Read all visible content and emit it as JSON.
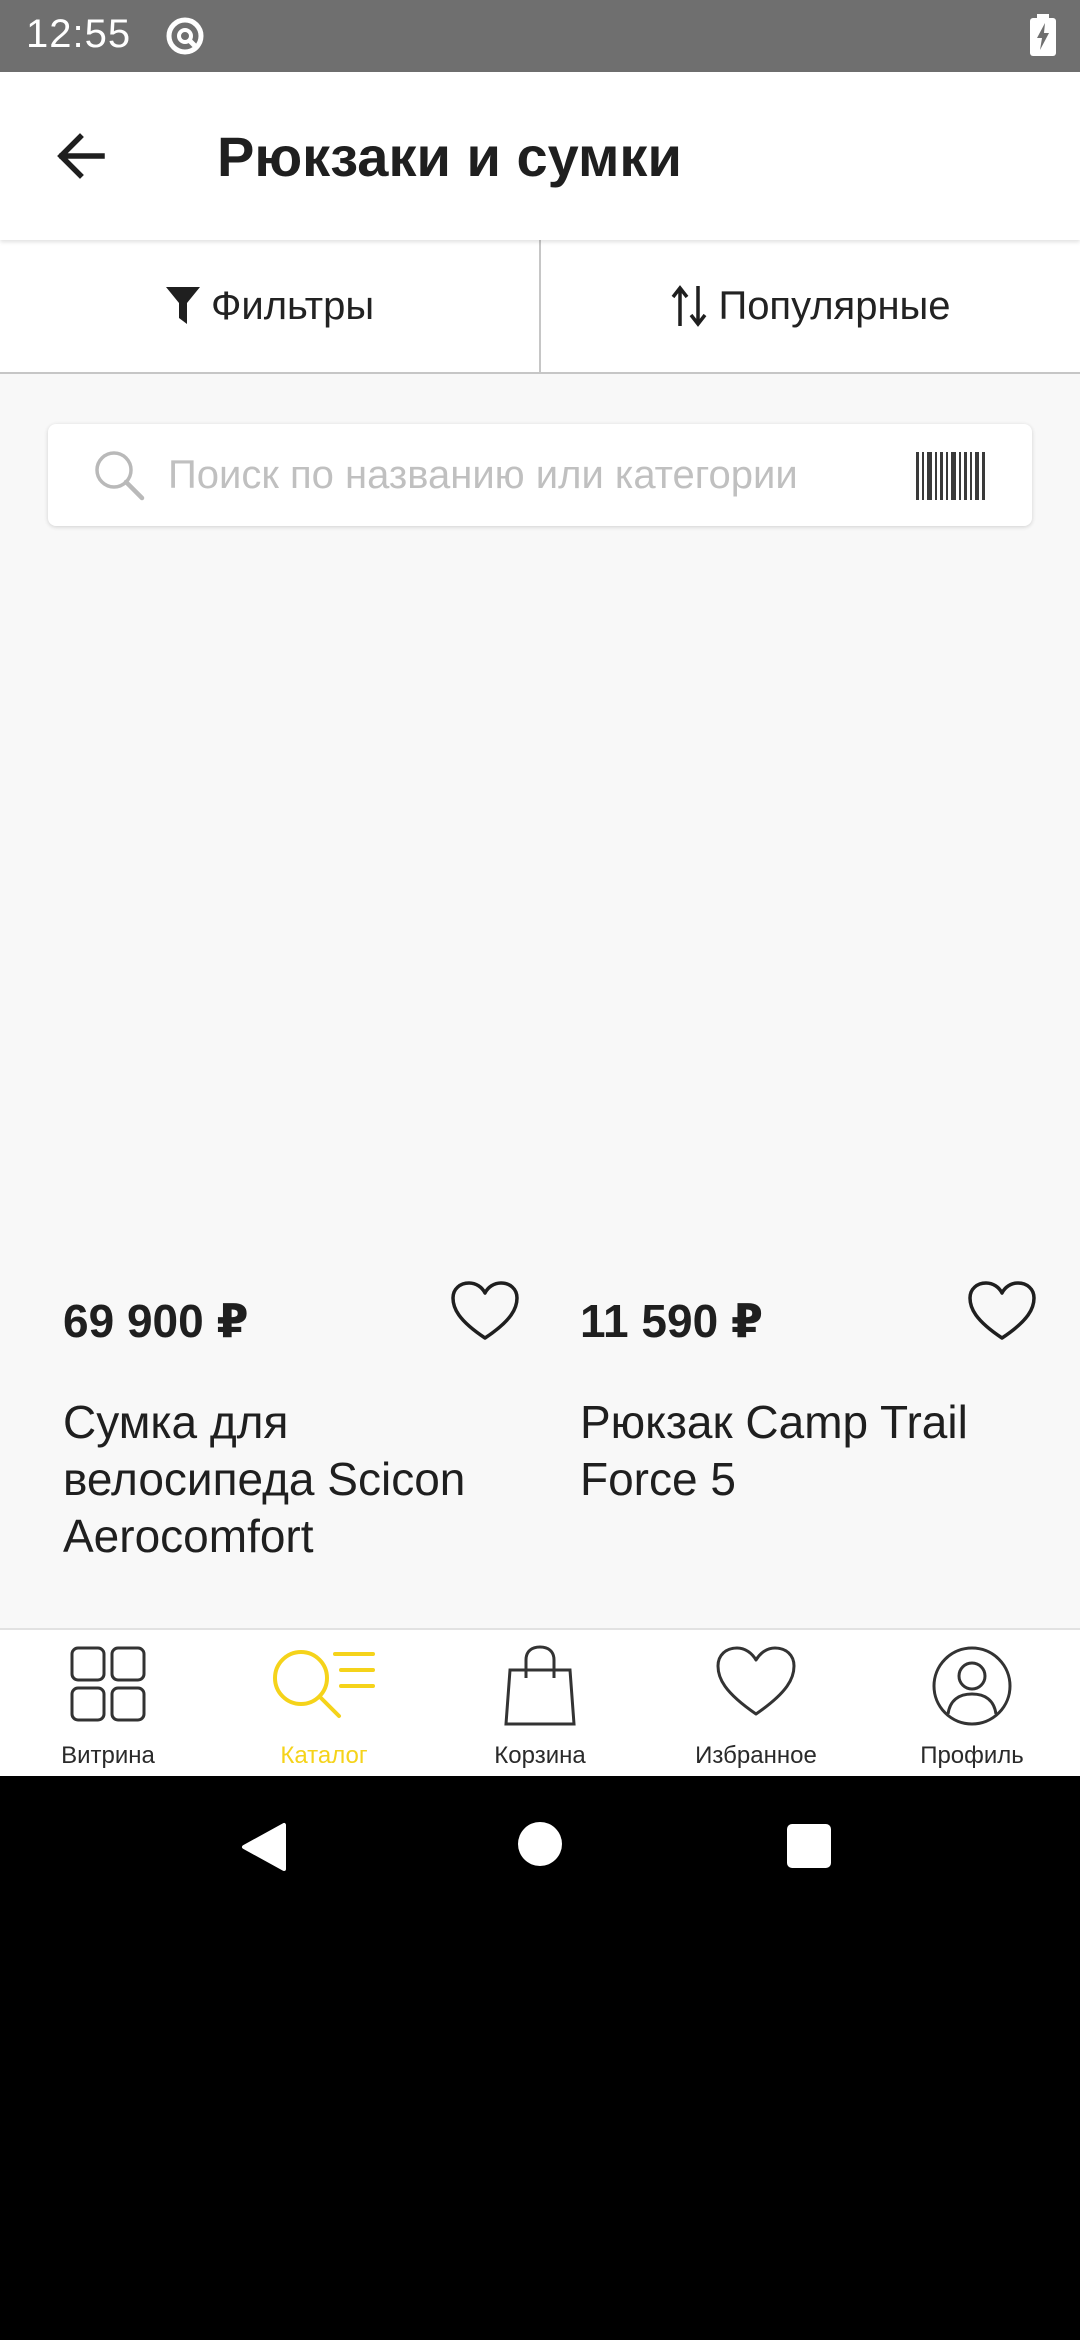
{
  "status_bar": {
    "time": "12:55",
    "icons": [
      "sync-icon",
      "battery-charging-icon"
    ]
  },
  "header": {
    "title": "Рюкзаки и сумки",
    "back_icon": "arrow-left-icon"
  },
  "toolbar": {
    "filters_label": "Фильтры",
    "filters_icon": "funnel-icon",
    "sort_label": "Популярные",
    "sort_icon": "sort-arrows-icon"
  },
  "search": {
    "placeholder": "Поиск по названию или категории",
    "value": "",
    "icon": "search-icon",
    "barcode_icon": "barcode-icon"
  },
  "products": [
    {
      "price": "69 900 ₽",
      "name": "Сумка для велосипеда Scicon Aerocomfort",
      "favorite": false
    },
    {
      "price": "11 590 ₽",
      "name": "Рюкзак Camp Trail Force 5",
      "favorite": false
    }
  ],
  "bottom_nav": {
    "items": [
      {
        "label": "Витрина",
        "icon": "grid-icon",
        "active": false
      },
      {
        "label": "Каталог",
        "icon": "catalog-search-icon",
        "active": true
      },
      {
        "label": "Корзина",
        "icon": "shopping-bag-icon",
        "active": false
      },
      {
        "label": "Избранное",
        "icon": "heart-icon",
        "active": false
      },
      {
        "label": "Профиль",
        "icon": "profile-icon",
        "active": false
      }
    ]
  },
  "colors": {
    "accent": "#f5d31a",
    "status_bar": "#6f6f6f",
    "background": "#f8f8f8",
    "text": "#1f1f1f"
  }
}
